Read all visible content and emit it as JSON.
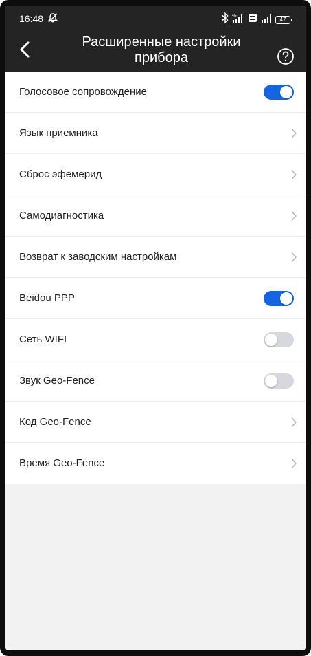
{
  "status_bar": {
    "time": "16:48",
    "battery": "47",
    "icons": [
      "muted-notification-icon",
      "bluetooth-icon",
      "signal-4g-icon",
      "volte-icon",
      "signal-icon",
      "battery-icon"
    ]
  },
  "header": {
    "title": "Расширенные настройки прибора",
    "back_icon": "chevron-left-icon",
    "help_icon": "question-circle-icon"
  },
  "colors": {
    "header_bg": "#242424",
    "toggle_on": "#1565e0",
    "toggle_off": "#d6d8de",
    "page_bg": "#f2f2f2"
  },
  "settings": {
    "items": [
      {
        "label": "Голосовое сопровождение",
        "type": "toggle",
        "on": true
      },
      {
        "label": "Язык приемника",
        "type": "link"
      },
      {
        "label": "Сброс эфемерид",
        "type": "link"
      },
      {
        "label": "Самодиагностика",
        "type": "link"
      },
      {
        "label": "Возврат к заводским настройкам",
        "type": "link"
      },
      {
        "label": "Beidou PPP",
        "type": "toggle",
        "on": true
      },
      {
        "label": "Сеть WIFI",
        "type": "toggle",
        "on": false
      },
      {
        "label": "Звук Geo-Fence",
        "type": "toggle",
        "on": false
      },
      {
        "label": "Код Geo-Fence",
        "type": "link"
      },
      {
        "label": "Время Geo-Fence",
        "type": "link"
      }
    ]
  }
}
